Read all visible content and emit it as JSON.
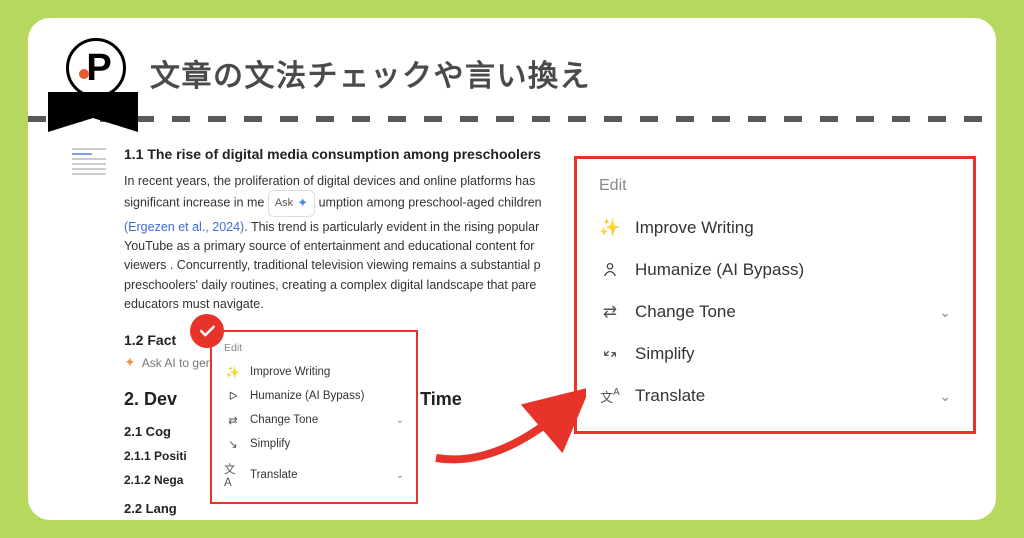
{
  "header": {
    "title": "文章の文法チェックや言い換え"
  },
  "doc": {
    "h11": "1.1 The rise of digital media consumption among preschoolers",
    "p1a": "In recent years, the proliferation of digital devices and online platforms has",
    "p1b": "significant increase in me",
    "ask_label": "Ask",
    "p1c": "umption among preschool-aged children",
    "cite": "(Ergezen et al., 2024)",
    "p1d": ". This trend is particularly evident in the rising popular",
    "p1e": "YouTube as a primary source of entertainment and educational content for",
    "p1f": "viewers . Concurrently, traditional television viewing remains a substantial p",
    "p1g": "preschoolers' daily routines, creating a complex digital landscape that pare",
    "p1h": "educators must navigate.",
    "h12": "1.2 Fact",
    "ai_placeholder": "Ask AI to generate or edit text..",
    "h2a": "2. Dev",
    "h2b": "reen Time",
    "h3a": "2.1 Cog",
    "h4a": "2.1.1 Positi",
    "h4b": "2.1.2 Nega",
    "h3b": "2.2 Lang"
  },
  "menu": {
    "label": "Edit",
    "items": [
      {
        "label": "Improve Writing",
        "icon": "sparkle",
        "chev": false
      },
      {
        "label": "Humanize (AI Bypass)",
        "icon": "person",
        "chev": false
      },
      {
        "label": "Change Tone",
        "icon": "swap",
        "chev": true
      },
      {
        "label": "Simplify",
        "icon": "contract",
        "chev": false
      },
      {
        "label": "Translate",
        "icon": "translate",
        "chev": true
      }
    ]
  }
}
